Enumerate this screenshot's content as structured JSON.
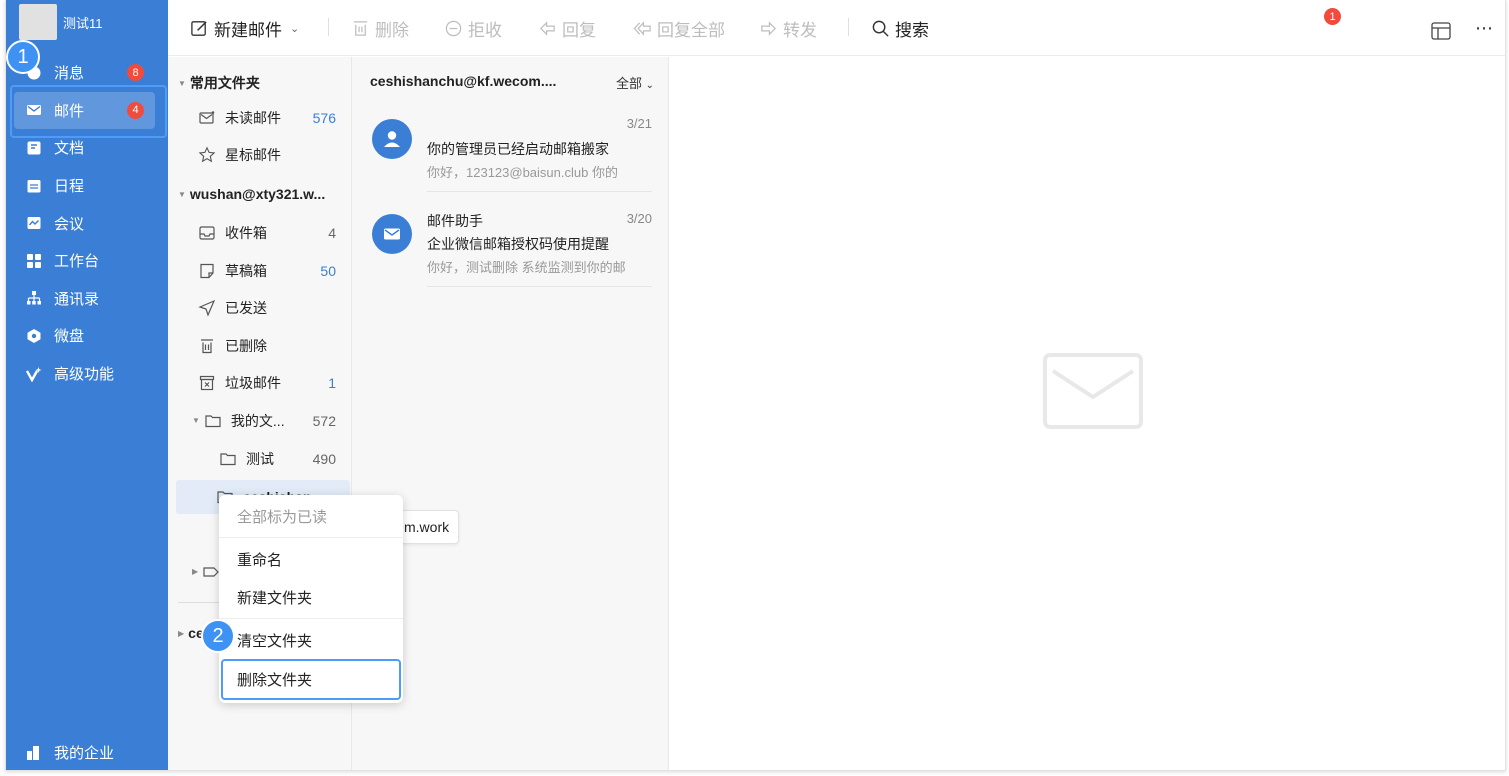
{
  "user": {
    "name": "测试11"
  },
  "nav": {
    "items": [
      {
        "label": "消息",
        "icon": "chat-icon",
        "badge": "8"
      },
      {
        "label": "邮件",
        "icon": "mail-icon",
        "badge": "4"
      },
      {
        "label": "文档",
        "icon": "doc-icon",
        "badge": ""
      },
      {
        "label": "日程",
        "icon": "calendar-icon",
        "badge": ""
      },
      {
        "label": "会议",
        "icon": "meeting-icon",
        "badge": ""
      },
      {
        "label": "工作台",
        "icon": "grid-icon",
        "badge": ""
      },
      {
        "label": "通讯录",
        "icon": "org-icon",
        "badge": ""
      },
      {
        "label": "微盘",
        "icon": "drive-icon",
        "badge": ""
      },
      {
        "label": "高级功能",
        "icon": "sparkle-icon",
        "badge": ""
      }
    ],
    "bottom_label": "我的企业"
  },
  "steps": {
    "one": "1",
    "two": "2"
  },
  "toolbar": {
    "compose": "新建邮件",
    "delete": "删除",
    "reject": "拒收",
    "reply": "回复",
    "reply_all": "回复全部",
    "forward": "转发",
    "search": "搜索",
    "more_badge": "1"
  },
  "folders": {
    "common_group": "常用文件夹",
    "unread": {
      "label": "未读邮件",
      "count": "576"
    },
    "starred": {
      "label": "星标邮件"
    },
    "account": "wushan@xty321.w...",
    "inbox": {
      "label": "收件箱",
      "count": "4"
    },
    "drafts": {
      "label": "草稿箱",
      "count": "50"
    },
    "sent": {
      "label": "已发送"
    },
    "deleted": {
      "label": "已删除"
    },
    "junk": {
      "label": "垃圾邮件",
      "count": "1"
    },
    "my_folders": {
      "label": "我的文...",
      "count": "572"
    },
    "test": {
      "label": "测试",
      "count": "490"
    },
    "selected": {
      "label": "ceshishan"
    },
    "other_account_short": "ce"
  },
  "mail_list": {
    "account": "ceshishanchu@kf.wecom....",
    "filter": "全部",
    "messages": [
      {
        "sender": "",
        "date": "3/21",
        "subject": "你的管理员已经启动邮箱搬家",
        "preview": "你好，123123@baisun.club 你的"
      },
      {
        "sender": "邮件助手",
        "date": "3/20",
        "subject": "企业微信邮箱授权码使用提醒",
        "preview": "你好，测试删除 系统监测到你的邮"
      }
    ]
  },
  "tooltip": "m.work",
  "context_menu": {
    "mark_all_read": "全部标为已读",
    "rename": "重命名",
    "new_folder": "新建文件夹",
    "empty_folder": "清空文件夹",
    "delete_folder": "删除文件夹"
  }
}
